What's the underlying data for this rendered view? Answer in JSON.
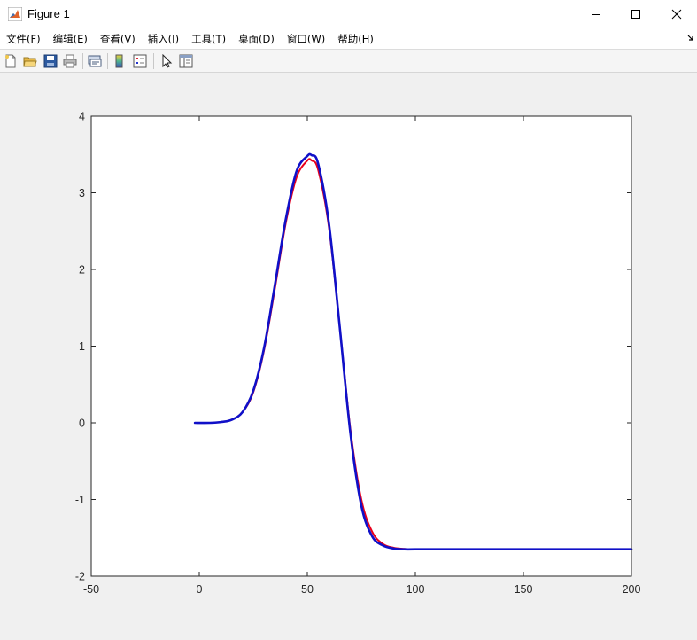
{
  "window": {
    "title": "Figure 1",
    "app_icon": "matlab-icon",
    "controls": [
      "minimize-icon",
      "maximize-icon",
      "close-icon"
    ]
  },
  "menu": {
    "items": [
      "文件(F)",
      "编辑(E)",
      "查看(V)",
      "插入(I)",
      "工具(T)",
      "桌面(D)",
      "窗口(W)",
      "帮助(H)"
    ]
  },
  "toolbar": {
    "buttons": [
      "new-figure-icon",
      "open-file-icon",
      "save-icon",
      "print-icon",
      "link-plot-icon",
      "insert-colorbar-icon",
      "insert-legend-icon",
      "edit-plot-icon",
      "property-inspector-icon"
    ]
  },
  "chart_data": {
    "type": "line",
    "title": "",
    "xlabel": "",
    "ylabel": "",
    "xlim": [
      -50,
      200
    ],
    "ylim": [
      -2,
      4
    ],
    "xticks": [
      -50,
      0,
      50,
      100,
      150,
      200
    ],
    "yticks": [
      -2,
      -1,
      0,
      1,
      2,
      3,
      4
    ],
    "grid": false,
    "legend": "none",
    "series": [
      {
        "color": "#e8001c",
        "x": [
          -2,
          5,
          10,
          15,
          20,
          25,
          30,
          35,
          40,
          45,
          50,
          52,
          55,
          60,
          65,
          70,
          75,
          80,
          85,
          90,
          95,
          100,
          120,
          150,
          200
        ],
        "y": [
          0,
          0,
          0.01,
          0.04,
          0.14,
          0.4,
          0.95,
          1.75,
          2.6,
          3.2,
          3.42,
          3.42,
          3.3,
          2.55,
          1.25,
          -0.1,
          -1.0,
          -1.42,
          -1.58,
          -1.63,
          -1.645,
          -1.65,
          -1.65,
          -1.65,
          -1.65
        ]
      },
      {
        "color": "#1010c8",
        "x": [
          -2,
          5,
          10,
          15,
          20,
          25,
          30,
          35,
          40,
          45,
          50,
          52,
          55,
          60,
          65,
          70,
          75,
          80,
          85,
          90,
          95,
          100,
          120,
          150,
          200
        ],
        "y": [
          0,
          0,
          0.01,
          0.04,
          0.14,
          0.42,
          0.98,
          1.8,
          2.65,
          3.28,
          3.48,
          3.49,
          3.38,
          2.6,
          1.25,
          -0.15,
          -1.08,
          -1.48,
          -1.6,
          -1.64,
          -1.65,
          -1.65,
          -1.65,
          -1.65,
          -1.65
        ]
      }
    ]
  }
}
